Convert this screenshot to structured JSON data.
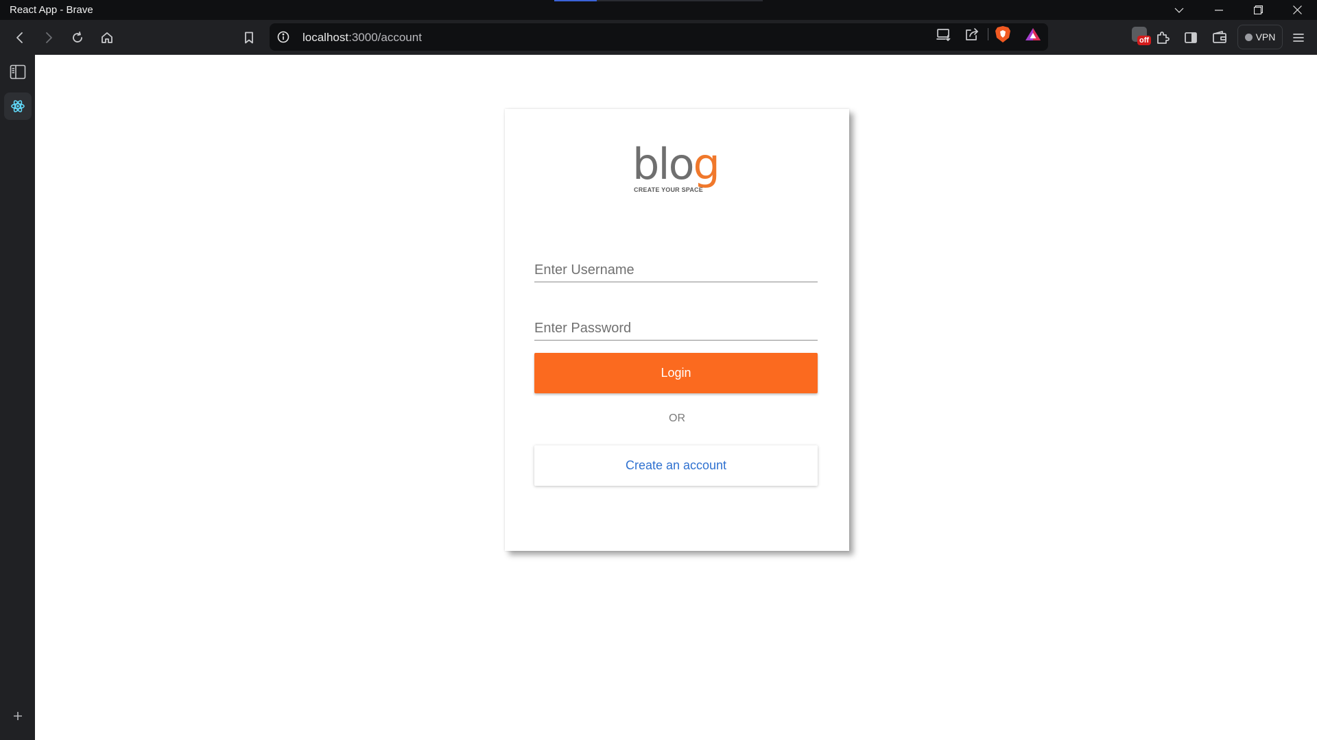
{
  "window": {
    "title": "React App - Brave"
  },
  "toolbar": {
    "url_host": "localhost",
    "url_path": ":3000/account",
    "vpn_label": "VPN",
    "shields_badge": "off"
  },
  "login_card": {
    "logo_text_main": "blo",
    "logo_text_accent": "g",
    "logo_tagline": "CREATE YOUR SPACE",
    "username_placeholder": "Enter Username",
    "password_placeholder": "Enter Password",
    "login_label": "Login",
    "or_label": "OR",
    "create_account_label": "Create an account"
  },
  "colors": {
    "accent": "#fb6a1f",
    "link": "#2f71d0",
    "logo_accent": "#f0782b"
  },
  "icons": [
    "back-icon",
    "forward-icon",
    "reload-icon",
    "home-icon",
    "bookmark-icon",
    "info-icon",
    "install-app-icon",
    "share-icon",
    "brave-shields-icon",
    "brave-rewards-icon",
    "extensions-icon",
    "sidebar-toggle-icon",
    "wallet-icon",
    "menu-icon",
    "react-devtools-icon",
    "add-icon"
  ]
}
